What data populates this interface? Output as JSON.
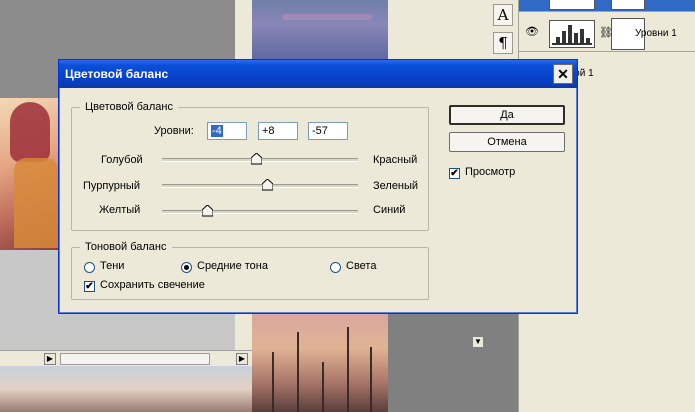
{
  "dialog": {
    "title": "Цветовой баланс",
    "close_glyph": "✕",
    "color_group": {
      "legend": "Цветовой баланс",
      "levels_label": "Уровни:",
      "levels": [
        "-4",
        "+8",
        "-57"
      ],
      "sliders": [
        {
          "left": "Голубой",
          "right": "Красный",
          "value": -4
        },
        {
          "left": "Пурпурный",
          "right": "Зеленый",
          "value": 8
        },
        {
          "left": "Желтый",
          "right": "Синий",
          "value": -57
        }
      ],
      "slider_range": [
        -100,
        100
      ]
    },
    "tone_group": {
      "legend": "Тоновой баланс",
      "radios": [
        {
          "label": "Тени",
          "checked": false
        },
        {
          "label": "Средние тона",
          "checked": true
        },
        {
          "label": "Света",
          "checked": false
        }
      ],
      "preserve_label": "Сохранить свечение",
      "preserve_checked": true
    },
    "ok_label": "Да",
    "cancel_label": "Отмена",
    "preview_label": "Просмотр",
    "preview_checked": true
  },
  "tools": {
    "text_tool_glyph": "A",
    "paragraph_glyph": "¶"
  },
  "layers": {
    "items": [
      {
        "name": "Уровни 1"
      },
      {
        "name": "Слой 1"
      }
    ]
  },
  "icons": {
    "eye": "eye-icon",
    "chain": "chain-link-icon",
    "check_mark": "✔"
  },
  "colors": {
    "titlebar": "#0840c8",
    "selection": "#316ac5"
  }
}
